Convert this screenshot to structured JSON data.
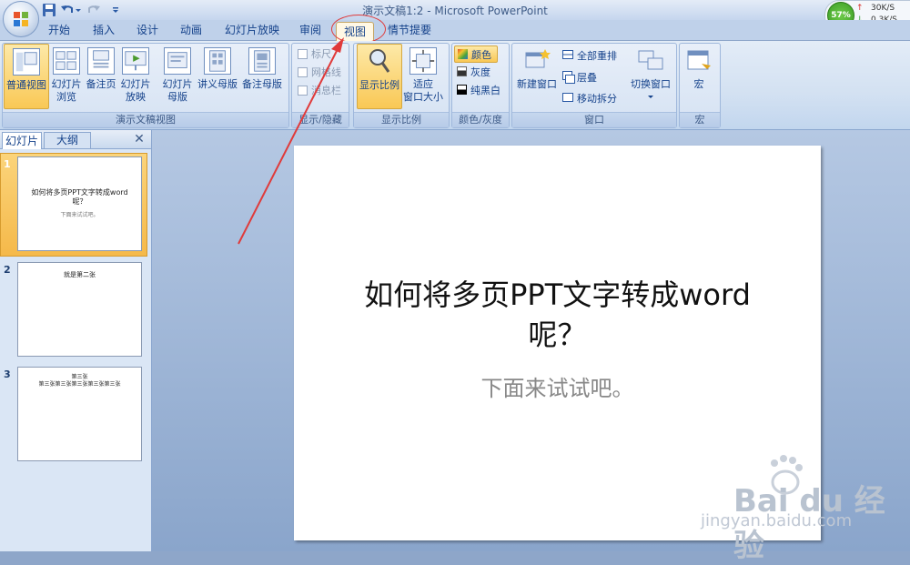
{
  "window": {
    "title": "演示文稿1:2 - Microsoft PowerPoint"
  },
  "net_monitor": {
    "percent": "57%",
    "up": "30K/S",
    "down": "0.3K/S"
  },
  "tabs": [
    "开始",
    "插入",
    "设计",
    "动画",
    "幻灯片放映",
    "审阅",
    "视图",
    "情节提要"
  ],
  "ribbon": {
    "group_presentation_views": {
      "label": "演示文稿视图",
      "buttons": [
        "普通视图",
        "幻灯片浏览",
        "备注页",
        "幻灯片放映",
        "幻灯片母版",
        "讲义母版",
        "备注母版"
      ],
      "button_lines": [
        [
          "普通视图"
        ],
        [
          "幻灯片",
          "浏览"
        ],
        [
          "备注页"
        ],
        [
          "幻灯片",
          "放映"
        ],
        [
          "幻灯片",
          "母版"
        ],
        [
          "讲义母版"
        ],
        [
          "备注母版"
        ]
      ]
    },
    "group_show_hide": {
      "label": "显示/隐藏",
      "items": [
        "标尺",
        "网格线",
        "消息栏"
      ]
    },
    "group_zoom": {
      "label": "显示比例",
      "zoom": "显示比例",
      "fit_lines": [
        "适应",
        "窗口大小"
      ]
    },
    "group_color": {
      "label": "颜色/灰度",
      "items": [
        "颜色",
        "灰度",
        "纯黑白"
      ]
    },
    "group_window": {
      "label": "窗口",
      "new_window": "新建窗口",
      "arrange_all": "全部重排",
      "cascade": "层叠",
      "move_split": "移动拆分",
      "switch_window": "切换窗口"
    },
    "group_macro": {
      "label": "宏",
      "macro": "宏"
    }
  },
  "slide_pane": {
    "tabs": [
      "幻灯片",
      "大纲"
    ],
    "slides": [
      {
        "num": "1",
        "title_lines": [
          "如何将多页PPT文字转成word",
          "呢？"
        ],
        "sub": "下面来试试吧。"
      },
      {
        "num": "2",
        "title_lines": [
          "就是第二张"
        ],
        "sub": ""
      },
      {
        "num": "3",
        "title_lines": [
          "第三张",
          "第三张第三张第三张第三张第三张"
        ],
        "sub": ""
      }
    ]
  },
  "slide": {
    "title_line1": "如何将多页PPT文字转成word",
    "title_line2": "呢？",
    "subtitle": "下面来试试吧。"
  },
  "watermark": {
    "brand": "Bai du 经验",
    "url": "jingyan.baidu.com"
  },
  "colors": {
    "annotation_red": "#e03a3a",
    "selected_tab_bg": "#fff8e5",
    "ribbon_bg": "#d3e1f2"
  }
}
